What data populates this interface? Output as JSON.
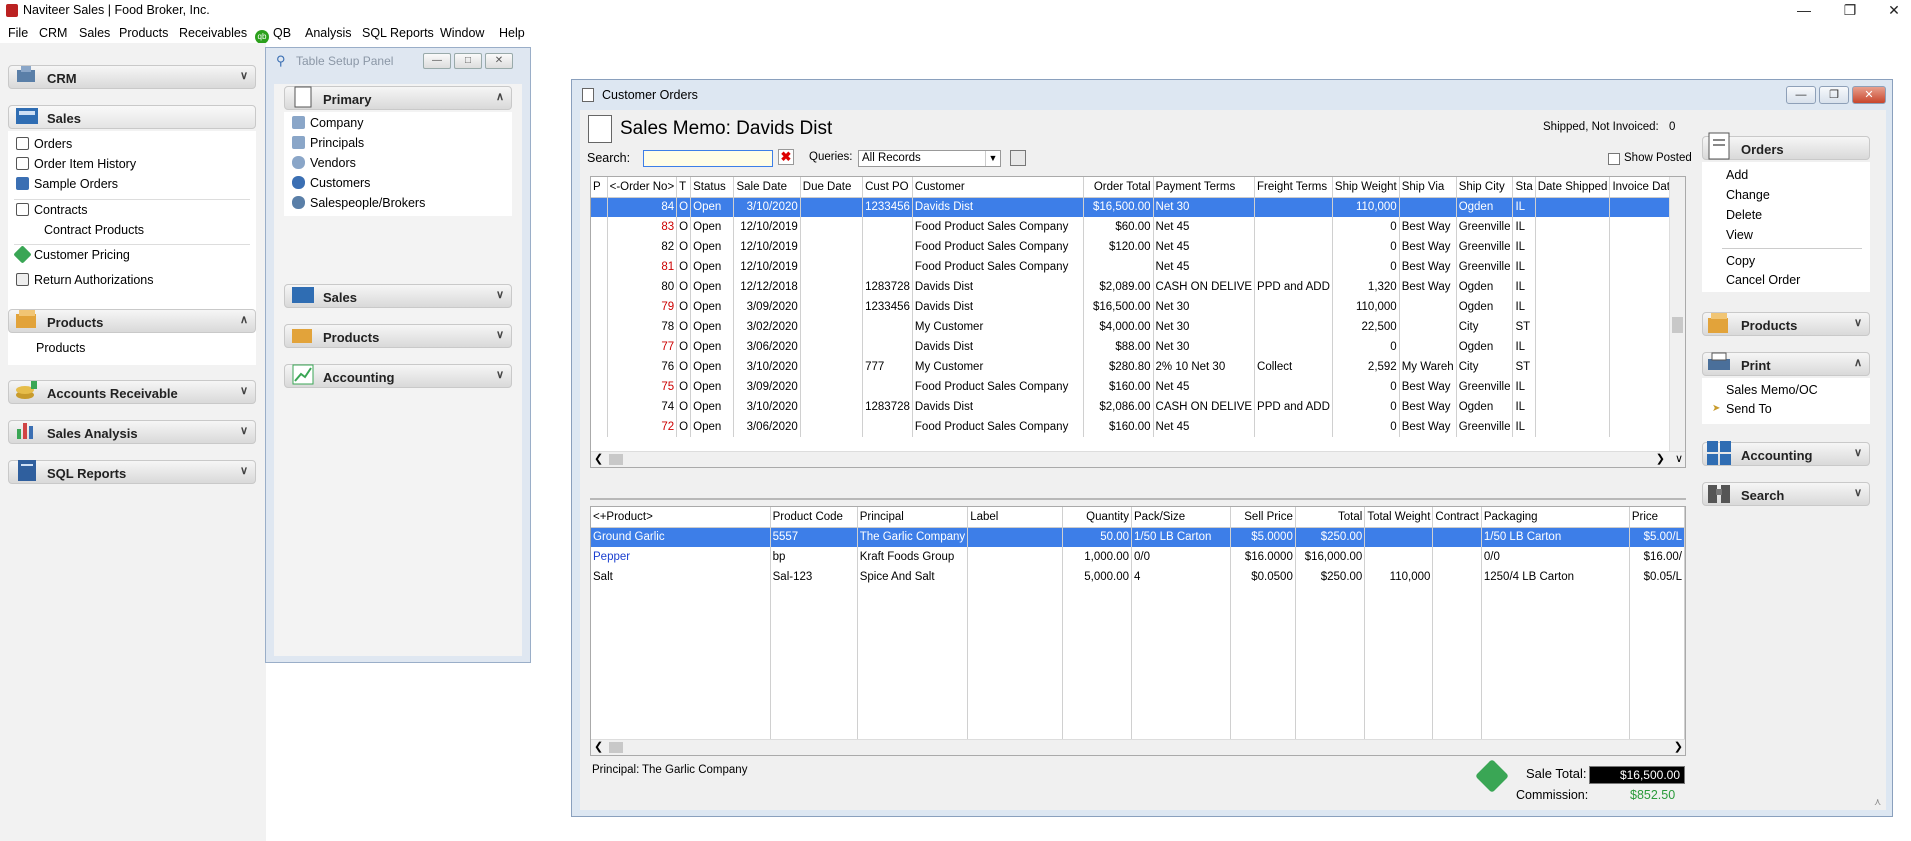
{
  "titlebar": {
    "title": "Naviteer Sales | Food Broker, Inc."
  },
  "menu": [
    "File",
    "CRM",
    "Sales",
    "Products",
    "Receivables",
    "QB",
    "Analysis",
    "SQL Reports",
    "Window",
    "Help"
  ],
  "qb_badge": "qb",
  "left": {
    "crm": "CRM",
    "sales": "Sales",
    "sales_items": [
      "Orders",
      "Order Item History",
      "Sample Orders",
      "Contracts",
      "Contract Products",
      "Customer Pricing",
      "Return Authorizations"
    ],
    "products": "Products",
    "products_items": [
      "Products"
    ],
    "ar": "Accounts Receivable",
    "sa": "Sales Analysis",
    "sql": "SQL Reports"
  },
  "tsp": {
    "caption": "Table Setup Panel",
    "primary": "Primary",
    "items": [
      "Company",
      "Principals",
      "Vendors",
      "Customers",
      "Salespeople/Brokers"
    ],
    "sales": "Sales",
    "products": "Products",
    "accounting": "Accounting"
  },
  "co": {
    "caption": "Customer Orders",
    "memo_title": "Sales Memo: Davids Dist",
    "shipped_label": "Shipped, Not Invoiced:",
    "shipped_value": "0",
    "search_label": "Search:",
    "search_value": "",
    "queries_label": "Queries:",
    "queries_value": "All Records",
    "show_posted": "Show Posted",
    "orders_cols": [
      "P",
      "<-Order No>",
      "T",
      "Status",
      "Sale Date",
      "Due Date",
      "Cust PO",
      "Customer",
      "Order Total",
      "Payment Terms",
      "Freight Terms",
      "Ship Weight",
      "Ship Via",
      "Ship City",
      "Sta",
      "Date Shipped",
      "Invoice Date"
    ],
    "orders": [
      {
        "p": "",
        "no": "84",
        "t": "O",
        "status": "Open",
        "sale": "3/10/2020",
        "due": "",
        "po": "1233456",
        "cust": "Davids Dist",
        "total": "$16,500.00",
        "pay": "Net 30",
        "freight": "",
        "wt": "110,000",
        "via": "",
        "city": "Ogden",
        "st": "IL",
        "shipped": "",
        "inv": "",
        "sel": true,
        "red": false
      },
      {
        "p": "",
        "no": "83",
        "t": "O",
        "status": "Open",
        "sale": "12/10/2019",
        "due": "",
        "po": "",
        "cust": "Food Product Sales Company",
        "total": "$60.00",
        "pay": "Net 45",
        "freight": "",
        "wt": "0",
        "via": "Best Way",
        "city": "Greenville",
        "st": "IL",
        "shipped": "",
        "inv": "",
        "sel": false,
        "red": true
      },
      {
        "p": "",
        "no": "82",
        "t": "O",
        "status": "Open",
        "sale": "12/10/2019",
        "due": "",
        "po": "",
        "cust": "Food Product Sales Company",
        "total": "$120.00",
        "pay": "Net 45",
        "freight": "",
        "wt": "0",
        "via": "Best Way",
        "city": "Greenville",
        "st": "IL",
        "shipped": "",
        "inv": "",
        "sel": false,
        "red": false
      },
      {
        "p": "",
        "no": "81",
        "t": "O",
        "status": "Open",
        "sale": "12/10/2019",
        "due": "",
        "po": "",
        "cust": "Food Product Sales Company",
        "total": "",
        "pay": "Net 45",
        "freight": "",
        "wt": "0",
        "via": "Best Way",
        "city": "Greenville",
        "st": "IL",
        "shipped": "",
        "inv": "",
        "sel": false,
        "red": true
      },
      {
        "p": "",
        "no": "80",
        "t": "O",
        "status": "Open",
        "sale": "12/12/2018",
        "due": "",
        "po": "1283728",
        "cust": "Davids Dist",
        "total": "$2,089.00",
        "pay": "CASH ON DELIVE",
        "freight": "PPD and ADD",
        "wt": "1,320",
        "via": "Best Way",
        "city": "Ogden",
        "st": "IL",
        "shipped": "",
        "inv": "",
        "sel": false,
        "red": false
      },
      {
        "p": "",
        "no": "79",
        "t": "O",
        "status": "Open",
        "sale": "3/09/2020",
        "due": "",
        "po": "1233456",
        "cust": "Davids Dist",
        "total": "$16,500.00",
        "pay": "Net 30",
        "freight": "",
        "wt": "110,000",
        "via": "",
        "city": "Ogden",
        "st": "IL",
        "shipped": "",
        "inv": "",
        "sel": false,
        "red": true
      },
      {
        "p": "",
        "no": "78",
        "t": "O",
        "status": "Open",
        "sale": "3/02/2020",
        "due": "",
        "po": "",
        "cust": "My Customer",
        "total": "$4,000.00",
        "pay": "Net 30",
        "freight": "",
        "wt": "22,500",
        "via": "",
        "city": "City",
        "st": "ST",
        "shipped": "",
        "inv": "",
        "sel": false,
        "red": false
      },
      {
        "p": "",
        "no": "77",
        "t": "O",
        "status": "Open",
        "sale": "3/06/2020",
        "due": "",
        "po": "",
        "cust": "Davids Dist",
        "total": "$88.00",
        "pay": "Net 30",
        "freight": "",
        "wt": "0",
        "via": "",
        "city": "Ogden",
        "st": "IL",
        "shipped": "",
        "inv": "",
        "sel": false,
        "red": true
      },
      {
        "p": "",
        "no": "76",
        "t": "O",
        "status": "Open",
        "sale": "3/10/2020",
        "due": "",
        "po": "777",
        "cust": "My Customer",
        "total": "$280.80",
        "pay": "2% 10 Net 30",
        "freight": "Collect",
        "wt": "2,592",
        "via": "My Wareh",
        "city": "City",
        "st": "ST",
        "shipped": "",
        "inv": "",
        "sel": false,
        "red": false
      },
      {
        "p": "",
        "no": "75",
        "t": "O",
        "status": "Open",
        "sale": "3/09/2020",
        "due": "",
        "po": "",
        "cust": "Food Product Sales Company",
        "total": "$160.00",
        "pay": "Net 45",
        "freight": "",
        "wt": "0",
        "via": "Best Way",
        "city": "Greenville",
        "st": "IL",
        "shipped": "",
        "inv": "",
        "sel": false,
        "red": true
      },
      {
        "p": "",
        "no": "74",
        "t": "O",
        "status": "Open",
        "sale": "3/10/2020",
        "due": "",
        "po": "1283728",
        "cust": "Davids Dist",
        "total": "$2,086.00",
        "pay": "CASH ON DELIVE",
        "freight": "PPD and ADD",
        "wt": "0",
        "via": "Best Way",
        "city": "Ogden",
        "st": "IL",
        "shipped": "",
        "inv": "",
        "sel": false,
        "red": false
      },
      {
        "p": "",
        "no": "72",
        "t": "O",
        "status": "Open",
        "sale": "3/06/2020",
        "due": "",
        "po": "",
        "cust": "Food Product Sales Company",
        "total": "$160.00",
        "pay": "Net 45",
        "freight": "",
        "wt": "0",
        "via": "Best Way",
        "city": "Greenville",
        "st": "IL",
        "shipped": "",
        "inv": "",
        "sel": false,
        "red": true
      }
    ],
    "items_cols": [
      "<+Product>",
      "Product Code",
      "Principal",
      "Label",
      "Quantity",
      "Pack/Size",
      "Sell Price",
      "Total",
      "Total Weight",
      "Contract",
      "Packaging",
      "Price"
    ],
    "items": [
      {
        "prod": "Ground Garlic",
        "code": "5557",
        "prin": "The Garlic Company",
        "label": "",
        "qty": "50.00",
        "pack": "1/50 LB Carton",
        "sell": "$5.0000",
        "total": "$250.00",
        "wt": "",
        "contract": "",
        "packg": "1/50 LB Carton",
        "price": "$5.00/L",
        "sel": true,
        "blue": false
      },
      {
        "prod": "Pepper",
        "code": "bp",
        "prin": "Kraft Foods Group",
        "label": "",
        "qty": "1,000.00",
        "pack": "0/0",
        "sell": "$16.0000",
        "total": "$16,000.00",
        "wt": "",
        "contract": "",
        "packg": "0/0",
        "price": "$16.00/",
        "sel": false,
        "blue": true
      },
      {
        "prod": "Salt",
        "code": "Sal-123",
        "prin": "Spice And Salt",
        "label": "",
        "qty": "5,000.00",
        "pack": "4",
        "sell": "$0.0500",
        "total": "$250.00",
        "wt": "110,000",
        "contract": "",
        "packg": "1250/4 LB Carton",
        "price": "$0.05/L",
        "sel": false,
        "blue": false
      }
    ],
    "principal_label": "Principal:",
    "principal_value": "The Garlic Company",
    "sale_total_label": "Sale Total:",
    "sale_total_value": "$16,500.00",
    "commission_label": "Commission:",
    "commission_value": "$852.50",
    "right": {
      "orders": "Orders",
      "actions": [
        "Add",
        "Change",
        "Delete",
        "View"
      ],
      "actions2": [
        "Copy",
        "Cancel Order"
      ],
      "products": "Products",
      "print": "Print",
      "print_items": [
        "Sales Memo/OC",
        "Send To"
      ],
      "accounting": "Accounting",
      "search": "Search"
    }
  }
}
